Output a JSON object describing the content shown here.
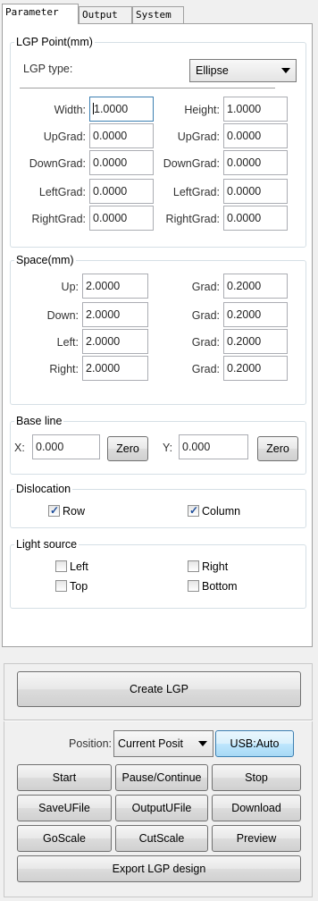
{
  "tabs": [
    "Parameter",
    "Output",
    "System"
  ],
  "lgp_point": {
    "legend": "LGP Point(mm)",
    "type_label": "LGP type:",
    "type_value": "Ellipse",
    "rows": [
      {
        "l1": "Width:",
        "v1": "1.0000",
        "l2": "Height:",
        "v2": "1.0000"
      },
      {
        "l1": "UpGrad:",
        "v1": "0.0000",
        "l2": "UpGrad:",
        "v2": "0.0000"
      },
      {
        "l1": "DownGrad:",
        "v1": "0.0000",
        "l2": "DownGrad:",
        "v2": "0.0000"
      },
      {
        "l1": "LeftGrad:",
        "v1": "0.0000",
        "l2": "LeftGrad:",
        "v2": "0.0000"
      },
      {
        "l1": "RightGrad:",
        "v1": "0.0000",
        "l2": "RightGrad:",
        "v2": "0.0000"
      }
    ]
  },
  "space": {
    "legend": "Space(mm)",
    "rows": [
      {
        "l1": "Up:",
        "v1": "2.0000",
        "l2": "Grad:",
        "v2": "0.2000"
      },
      {
        "l1": "Down:",
        "v1": "2.0000",
        "l2": "Grad:",
        "v2": "0.2000"
      },
      {
        "l1": "Left:",
        "v1": "2.0000",
        "l2": "Grad:",
        "v2": "0.2000"
      },
      {
        "l1": "Right:",
        "v1": "2.0000",
        "l2": "Grad:",
        "v2": "0.2000"
      }
    ]
  },
  "baseline": {
    "legend": "Base line",
    "x_label": "X:",
    "x_value": "0.000",
    "y_label": "Y:",
    "y_value": "0.000",
    "zero_label": "Zero"
  },
  "dislocation": {
    "legend": "Dislocation",
    "row_label": "Row",
    "row_checked": true,
    "column_label": "Column",
    "column_checked": true
  },
  "light_source": {
    "legend": "Light source",
    "left": "Left",
    "right": "Right",
    "top": "Top",
    "bottom": "Bottom"
  },
  "create_label": "Create LGP",
  "position_label": "Position:",
  "position_value": "Current Posit",
  "usb_label": "USB:Auto",
  "buttons": [
    [
      "Start",
      "Pause/Continue",
      "Stop"
    ],
    [
      "SaveUFile",
      "OutputUFile",
      "Download"
    ],
    [
      "GoScale",
      "CutScale",
      "Preview"
    ]
  ],
  "export_label": "Export LGP design"
}
